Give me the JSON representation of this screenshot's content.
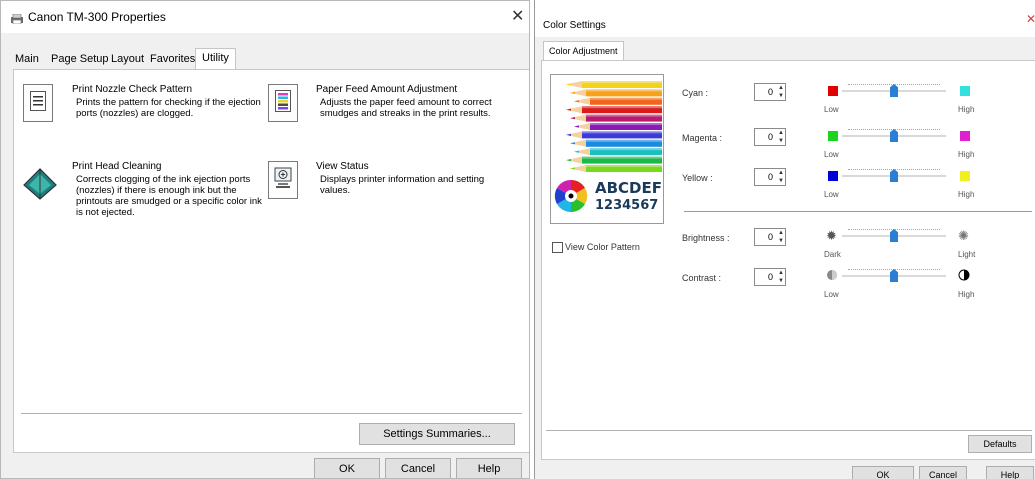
{
  "w1": {
    "title": "Canon TM-300 Properties",
    "tabs": [
      "Main",
      "Page Setup",
      "Layout",
      "Favorites",
      "Utility"
    ],
    "items": [
      {
        "title": "Print Nozzle Check Pattern",
        "desc": [
          "Prints the pattern for checking if the ejection",
          "ports (nozzles) are clogged."
        ]
      },
      {
        "title": "Paper Feed Amount Adjustment",
        "desc": [
          "Adjusts the paper feed amount to correct",
          "smudges and streaks in the print results."
        ]
      },
      {
        "title": "Print Head Cleaning",
        "desc": [
          "Corrects clogging of the ink ejection ports",
          "(nozzles) if there is enough ink but the",
          "printouts are smudged or a specific color ink",
          "is not ejected."
        ]
      },
      {
        "title": "View Status",
        "desc": [
          "Displays printer information and setting",
          "values."
        ]
      }
    ],
    "settings_summaries": "Settings Summaries...",
    "ok": "OK",
    "cancel": "Cancel",
    "help": "Help"
  },
  "w2": {
    "title": "Color Settings",
    "tab": "Color Adjustment",
    "preview_text1": "ABCDEF",
    "preview_text2": "1234567",
    "view_pattern": "View Color Pattern",
    "rows": [
      {
        "label": "Cyan :",
        "value": "0",
        "low": "Low",
        "high": "High",
        "level": 0.5,
        "low_color": "#e00000",
        "high_color": "#33e0e0"
      },
      {
        "label": "Magenta :",
        "value": "0",
        "low": "Low",
        "high": "High",
        "level": 0.5,
        "low_color": "#1bd41b",
        "high_color": "#e020d0"
      },
      {
        "label": "Yellow :",
        "value": "0",
        "low": "Low",
        "high": "High",
        "level": 0.5,
        "low_color": "#0000d8",
        "high_color": "#f0f020"
      },
      {
        "label": "Brightness :",
        "value": "0",
        "low": "Dark",
        "high": "Light",
        "level": 0.5
      },
      {
        "label": "Contrast :",
        "value": "0",
        "low": "Low",
        "high": "High",
        "level": 0.5
      }
    ],
    "defaults": "Defaults",
    "ok": "OK",
    "cancel": "Cancel",
    "help": "Help"
  }
}
